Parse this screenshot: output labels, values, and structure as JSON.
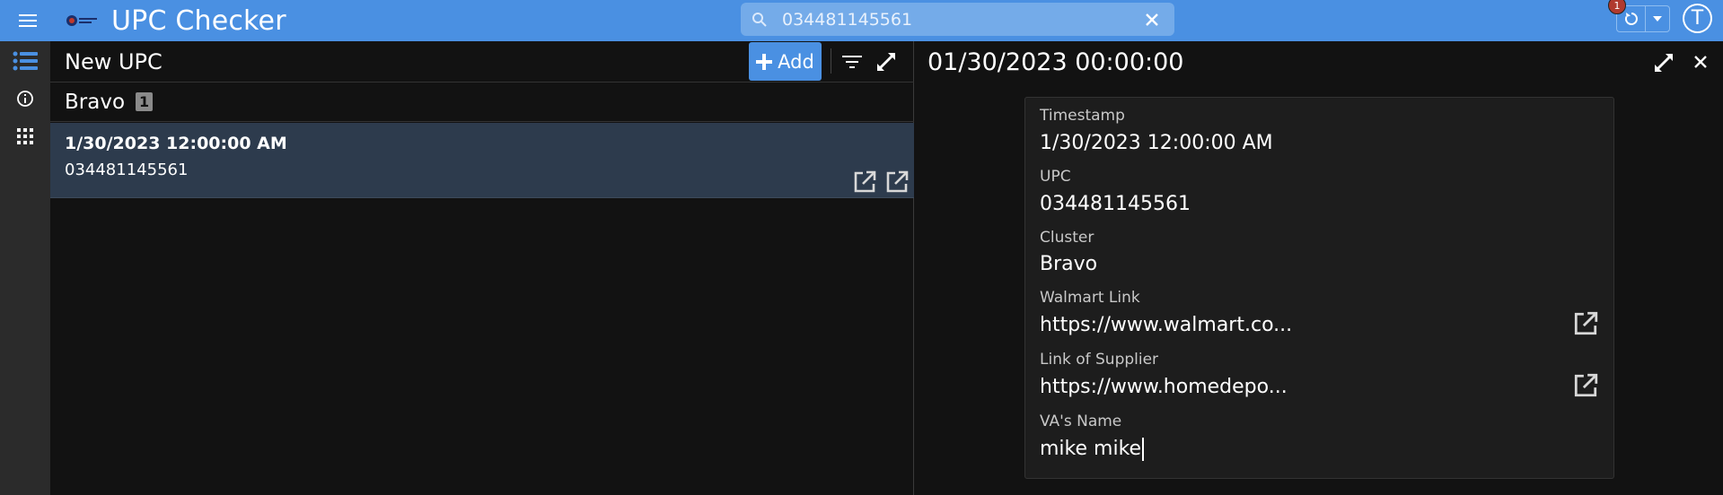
{
  "app": {
    "title": "UPC Checker",
    "notification_count": "1",
    "avatar_letter": "T"
  },
  "search": {
    "value": "034481145561",
    "placeholder": ""
  },
  "rail": {
    "items": [
      {
        "icon": "list-icon",
        "active": true
      },
      {
        "icon": "info-icon",
        "active": false
      },
      {
        "icon": "grid-icon",
        "active": false
      }
    ]
  },
  "left_panel": {
    "title": "New UPC",
    "add_label": "Add",
    "group": {
      "label": "Bravo",
      "count": "1"
    },
    "items": [
      {
        "date": "1/30/2023 12:00:00 AM",
        "upc": "034481145561"
      }
    ]
  },
  "detail": {
    "title": "01/30/2023 00:00:00",
    "fields": {
      "timestamp": {
        "label": "Timestamp",
        "value": "1/30/2023 12:00:00 AM"
      },
      "upc": {
        "label": "UPC",
        "value": "034481145561"
      },
      "cluster": {
        "label": "Cluster",
        "value": "Bravo"
      },
      "walmart_link": {
        "label": "Walmart Link",
        "value": "https://www.walmart.co..."
      },
      "supplier_link": {
        "label": "Link of Supplier",
        "value": "https://www.homedepo..."
      },
      "va_name": {
        "label": "VA's Name",
        "value": "mike mike"
      }
    }
  },
  "colors": {
    "topbar": "#4a90e2",
    "background": "#121212",
    "rail": "#2b2b2b",
    "selected_row": "#2d3b4d",
    "card": "#1d1d1d"
  }
}
